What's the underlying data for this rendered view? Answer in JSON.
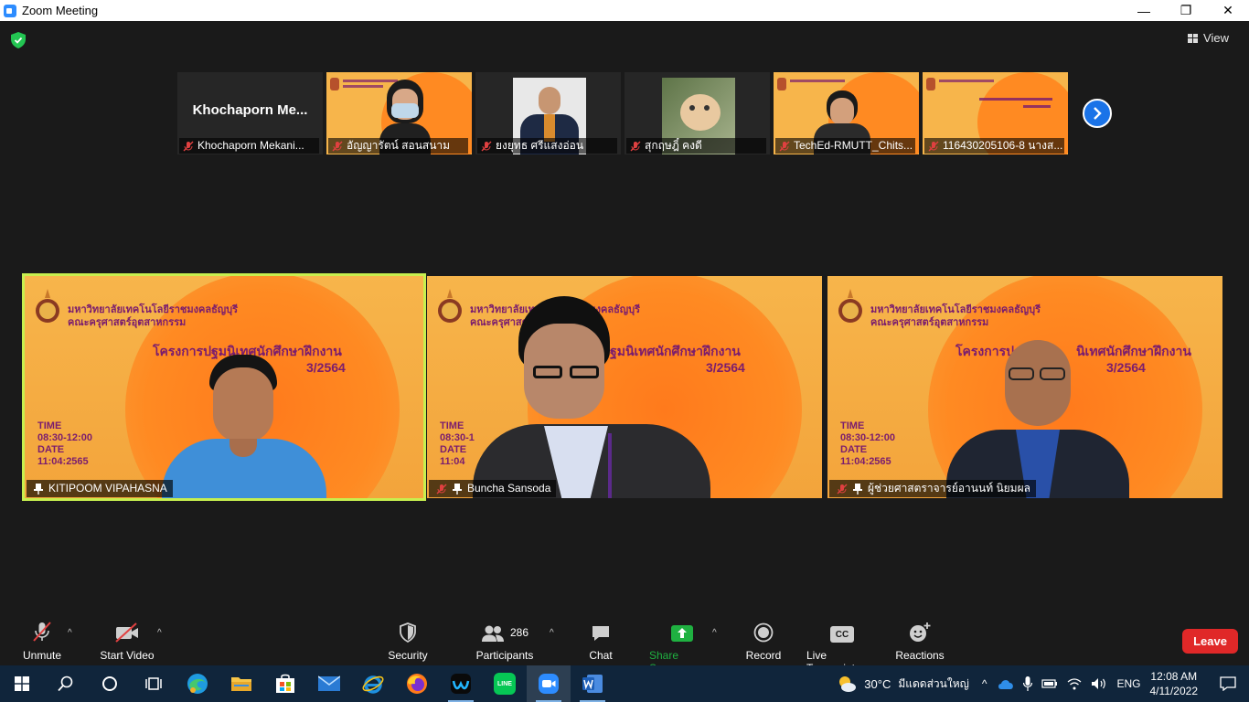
{
  "window": {
    "title": "Zoom Meeting",
    "minimize": "—",
    "maximize": "❐",
    "close": "✕"
  },
  "view_button": {
    "label": "View"
  },
  "gallery": [
    {
      "name": "Khochaporn Mekani...",
      "card_text": "Khochaporn  Me...",
      "muted": true,
      "kind": "name"
    },
    {
      "name": "อัญญารัตน์ สอนสนาม",
      "muted": true,
      "kind": "slide-person"
    },
    {
      "name": "ยงยุทธ ศรีแสงอ่อน",
      "muted": true,
      "kind": "photo"
    },
    {
      "name": "สุกฤษฎิ์ คงดี",
      "muted": true,
      "kind": "cat"
    },
    {
      "name": "TechEd-RMUTT_Chits...",
      "muted": true,
      "kind": "slide-person"
    },
    {
      "name": "116430205106-8 นางส...",
      "muted": true,
      "kind": "slide"
    }
  ],
  "slide": {
    "uni_line1": "มหาวิทยาลัยเทคโนโลยีราชมงคลธัญบุรี",
    "uni_line2": "คณะครุศาสตร์อุตสาหกรรม",
    "project": "โครงการปฐมนิเทศนักศึกษาฝึกงาน",
    "project_partial_a": "โครงการป",
    "project_partial_b": "นิเทศนักศึกษาฝึกงาน",
    "project_partial_c": "ฐมนิเทศนักศึกษาฝึกงาน",
    "term": "3/2564",
    "time_label": "TIME",
    "time_value": "08:30-12:00",
    "time_value_partial": "08:30-1",
    "date_label": "DATE",
    "date_value": "11:04:2565",
    "date_value_partial": "11:04"
  },
  "main_tiles": [
    {
      "name": "KITIPOOM VIPAHASNA",
      "muted": false,
      "pinned": true,
      "active": true
    },
    {
      "name": "Buncha Sansoda",
      "muted": true,
      "pinned": true,
      "active": false
    },
    {
      "name": "ผู้ช่วยศาสตราจารย์อานนท์ นิยมผล",
      "muted": true,
      "pinned": true,
      "active": false
    }
  ],
  "toolbar": {
    "unmute": "Unmute",
    "start_video": "Start Video",
    "security": "Security",
    "participants": "Participants",
    "participants_count": "286",
    "chat": "Chat",
    "share_screen": "Share Screen",
    "record": "Record",
    "live_transcript": "Live Transcript",
    "cc": "CC",
    "reactions": "Reactions",
    "leave": "Leave",
    "caret": "^"
  },
  "taskbar": {
    "weather_temp": "30°C",
    "weather_text": "มีแดดส่วนใหญ่",
    "lang": "ENG",
    "time": "12:08 AM",
    "date": "4/11/2022",
    "line_label": "LINE"
  },
  "colors": {
    "accent_blue": "#2d8cff",
    "leave_red": "#e02828",
    "share_green": "#1fb141",
    "active_speaker": "#c7ef4f",
    "slide_orange": "#f7b54b",
    "slide_text": "#7a1c6e",
    "muted_red": "#e04040"
  }
}
